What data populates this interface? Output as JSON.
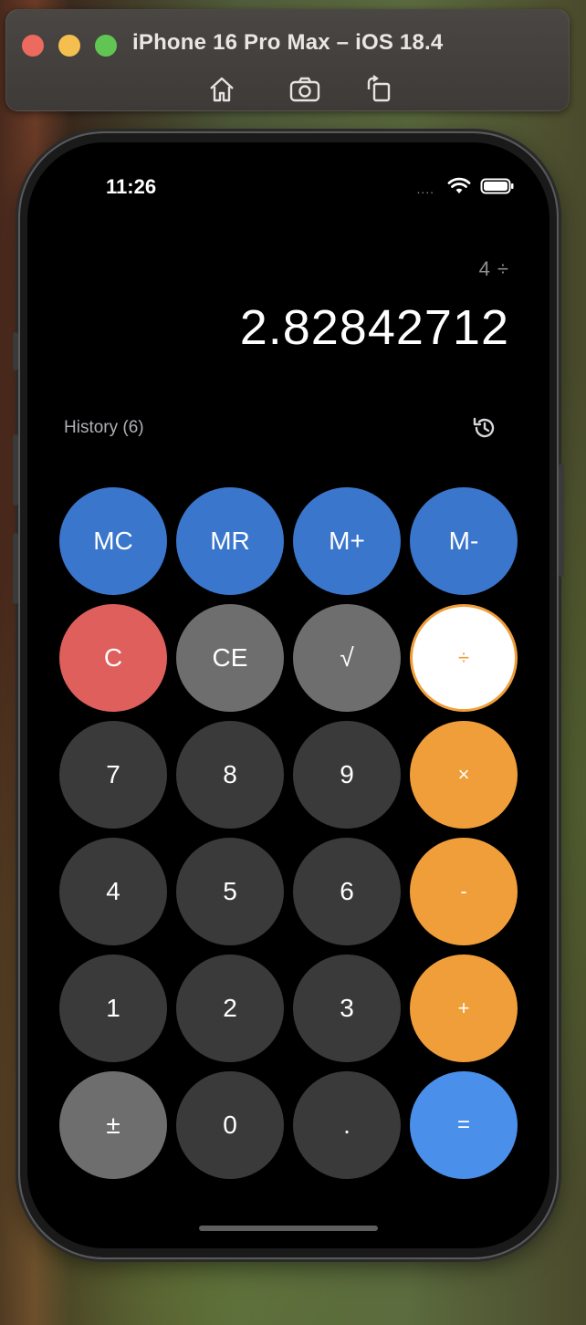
{
  "window": {
    "title": "iPhone 16 Pro Max – iOS 18.4",
    "toolbar_icons": [
      "home-icon",
      "screenshot-icon",
      "rotate-icon"
    ]
  },
  "status_bar": {
    "time": "11:26",
    "dots": "....",
    "icons": [
      "wifi-icon",
      "battery-icon"
    ]
  },
  "calculator": {
    "expression": "4 ÷",
    "display": "2.82842712",
    "history_label": "History (6)",
    "keys": [
      {
        "name": "mc-button",
        "label": "MC",
        "kind": "mem"
      },
      {
        "name": "mr-button",
        "label": "MR",
        "kind": "mem"
      },
      {
        "name": "m-plus-button",
        "label": "M+",
        "kind": "mem"
      },
      {
        "name": "m-minus-button",
        "label": "M-",
        "kind": "mem"
      },
      {
        "name": "clear-button",
        "label": "C",
        "kind": "clear"
      },
      {
        "name": "clear-entry-button",
        "label": "CE",
        "kind": "func"
      },
      {
        "name": "sqrt-button",
        "label": "√",
        "kind": "func"
      },
      {
        "name": "divide-button",
        "label": "÷",
        "kind": "op-active"
      },
      {
        "name": "digit-7-button",
        "label": "7",
        "kind": "num"
      },
      {
        "name": "digit-8-button",
        "label": "8",
        "kind": "num"
      },
      {
        "name": "digit-9-button",
        "label": "9",
        "kind": "num"
      },
      {
        "name": "multiply-button",
        "label": "×",
        "kind": "op"
      },
      {
        "name": "digit-4-button",
        "label": "4",
        "kind": "num"
      },
      {
        "name": "digit-5-button",
        "label": "5",
        "kind": "num"
      },
      {
        "name": "digit-6-button",
        "label": "6",
        "kind": "num"
      },
      {
        "name": "subtract-button",
        "label": "-",
        "kind": "op"
      },
      {
        "name": "digit-1-button",
        "label": "1",
        "kind": "num"
      },
      {
        "name": "digit-2-button",
        "label": "2",
        "kind": "num"
      },
      {
        "name": "digit-3-button",
        "label": "3",
        "kind": "num"
      },
      {
        "name": "add-button",
        "label": "+",
        "kind": "op"
      },
      {
        "name": "plus-minus-button",
        "label": "±",
        "kind": "func"
      },
      {
        "name": "digit-0-button",
        "label": "0",
        "kind": "num"
      },
      {
        "name": "decimal-button",
        "label": ".",
        "kind": "num"
      },
      {
        "name": "equals-button",
        "label": "=",
        "kind": "eq"
      }
    ]
  },
  "colors": {
    "memory": "#3a76cc",
    "clear": "#de5f5b",
    "function": "#6e6e6e",
    "number": "#3a3a3a",
    "operator": "#f09e3a",
    "equals": "#4a90ea"
  }
}
